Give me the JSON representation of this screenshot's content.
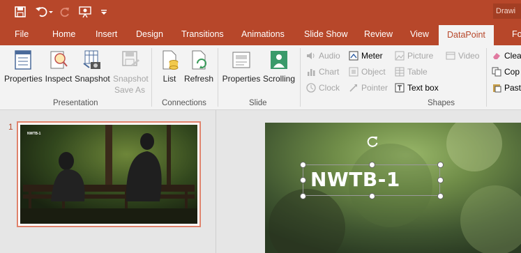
{
  "title_bar": {
    "title_partial": "Drawi",
    "qat": [
      "save-icon",
      "undo-icon",
      "redo-icon",
      "present-icon",
      "customize-icon"
    ]
  },
  "tabs": [
    {
      "label": "File"
    },
    {
      "label": "Home"
    },
    {
      "label": "Insert"
    },
    {
      "label": "Design"
    },
    {
      "label": "Transitions"
    },
    {
      "label": "Animations"
    },
    {
      "label": "Slide Show"
    },
    {
      "label": "Review"
    },
    {
      "label": "View"
    },
    {
      "label": "DataPoint",
      "active": true
    },
    {
      "label": "Fo"
    }
  ],
  "ribbon": {
    "presentation": {
      "label": "Presentation",
      "properties": "Properties",
      "inspect": "Inspect",
      "snapshot": "Snapshot",
      "snapshot_save_as_1": "Snapshot",
      "snapshot_save_as_2": "Save As"
    },
    "connections": {
      "label": "Connections",
      "list": "List",
      "refresh": "Refresh"
    },
    "slide": {
      "label": "Slide",
      "properties": "Properties",
      "scrolling": "Scrolling"
    },
    "shapes": {
      "label": "Shapes",
      "audio": "Audio",
      "meter": "Meter",
      "picture": "Picture",
      "video": "Video",
      "chart": "Chart",
      "object": "Object",
      "table": "Table",
      "clock": "Clock",
      "pointer": "Pointer",
      "text_box": "Text box"
    },
    "edit": {
      "clear": "Clea",
      "copy": "Cop",
      "paste": "Past"
    }
  },
  "thumbnails": {
    "slide_number": "1",
    "thumb_title": "NWTB-1"
  },
  "slide": {
    "textbox_text": "NWTB-1"
  },
  "colors": {
    "accent": "#b7472a",
    "ribbon_bg": "#f3f3f3",
    "selected_thumb_border": "#e0826b"
  }
}
